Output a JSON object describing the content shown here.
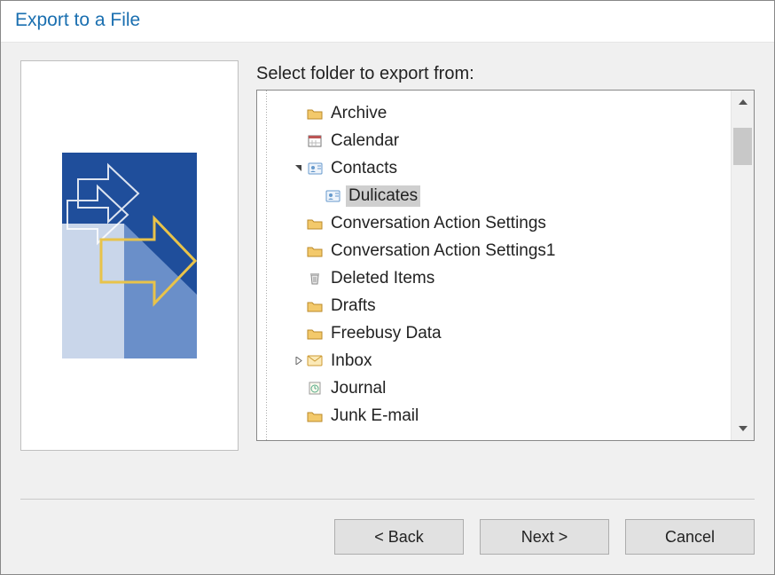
{
  "window": {
    "title": "Export to a File"
  },
  "prompt": "Select folder to export from:",
  "tree": {
    "items": [
      {
        "icon": "folder",
        "label": "Archive",
        "depth": 1,
        "toggle": ""
      },
      {
        "icon": "calendar",
        "label": "Calendar",
        "depth": 1,
        "toggle": ""
      },
      {
        "icon": "contacts",
        "label": "Contacts",
        "depth": 1,
        "toggle": "expanded"
      },
      {
        "icon": "contacts",
        "label": "Dulicates",
        "depth": 2,
        "toggle": "",
        "selected": true
      },
      {
        "icon": "folder",
        "label": "Conversation Action Settings",
        "depth": 1,
        "toggle": ""
      },
      {
        "icon": "folder",
        "label": "Conversation Action Settings1",
        "depth": 1,
        "toggle": ""
      },
      {
        "icon": "deleted",
        "label": "Deleted Items",
        "depth": 1,
        "toggle": ""
      },
      {
        "icon": "folder",
        "label": "Drafts",
        "depth": 1,
        "toggle": ""
      },
      {
        "icon": "folder",
        "label": "Freebusy Data",
        "depth": 1,
        "toggle": ""
      },
      {
        "icon": "inbox",
        "label": "Inbox",
        "depth": 1,
        "toggle": "collapsed"
      },
      {
        "icon": "journal",
        "label": "Journal",
        "depth": 1,
        "toggle": ""
      },
      {
        "icon": "folder",
        "label": "Junk E-mail",
        "depth": 1,
        "toggle": ""
      }
    ]
  },
  "buttons": {
    "back": "< Back",
    "next": "Next >",
    "cancel": "Cancel"
  }
}
